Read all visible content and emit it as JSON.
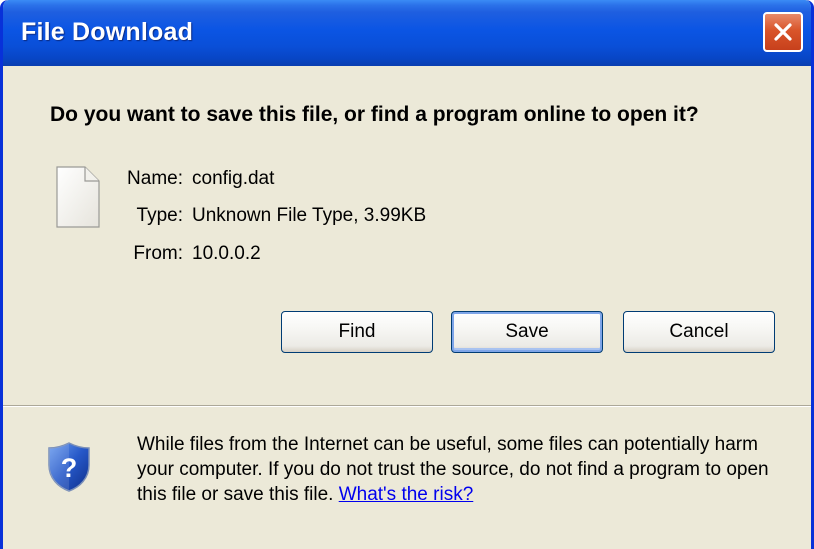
{
  "window": {
    "title": "File Download",
    "close_icon": "close-icon",
    "titlebar_color": "#0a4fd8",
    "close_color": "#d9552a"
  },
  "dialog": {
    "question": "Do you want to save this file, or find a program online to open it?",
    "file_icon": "document-icon",
    "fields": [
      {
        "label": "Name:",
        "value": "config.dat"
      },
      {
        "label": "Type:",
        "value": "Unknown File Type, 3.99KB"
      },
      {
        "label": "From:",
        "value": "10.0.0.2"
      }
    ],
    "buttons": {
      "find": "Find",
      "save": "Save",
      "cancel": "Cancel"
    }
  },
  "warning": {
    "icon": "shield-question-icon",
    "text": "While files from the Internet can be useful, some files can potentially harm your computer. If you do not trust the source, do not find a program to open this file or save this file.",
    "link": "What's the risk?"
  }
}
